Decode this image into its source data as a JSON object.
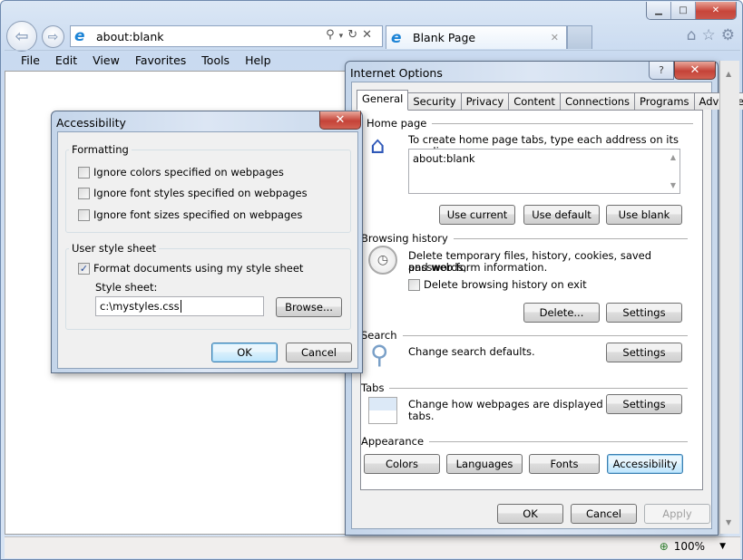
{
  "browser": {
    "address": "about:blank",
    "address_tools": [
      "search-icon",
      "dropdown-icon",
      "refresh-icon",
      "stop-icon"
    ],
    "tab_title": "Blank Page",
    "menu": [
      "File",
      "Edit",
      "View",
      "Favorites",
      "Tools",
      "Help"
    ],
    "right_icons": [
      "home-icon",
      "favorites-star-icon",
      "tools-gear-icon"
    ],
    "zoom_level": "100%"
  },
  "accessibility": {
    "title": "Accessibility",
    "formatting": {
      "label": "Formatting",
      "options": [
        {
          "label": "Ignore colors specified on webpages",
          "checked": false
        },
        {
          "label": "Ignore font styles specified on webpages",
          "checked": false
        },
        {
          "label": "Ignore font sizes specified on webpages",
          "checked": false
        }
      ]
    },
    "user_style": {
      "label": "User style sheet",
      "format_label": "Format documents using my style sheet",
      "format_checked": true,
      "sheet_label": "Style sheet:",
      "sheet_value": "c:\\mystyles.css",
      "browse": "Browse..."
    },
    "ok": "OK",
    "cancel": "Cancel"
  },
  "internet_options": {
    "title": "Internet Options",
    "tabs": [
      "General",
      "Security",
      "Privacy",
      "Content",
      "Connections",
      "Programs",
      "Advanced"
    ],
    "active_tab": "General",
    "home_page": {
      "label": "Home page",
      "desc": "To create home page tabs, type each address on its own line.",
      "value": "about:blank",
      "use_current": "Use current",
      "use_default": "Use default",
      "use_blank": "Use blank"
    },
    "history": {
      "label": "Browsing history",
      "desc1": "Delete temporary files, history, cookies, saved passwords,",
      "desc2": "and web form information.",
      "on_exit": "Delete browsing history on exit",
      "on_exit_checked": false,
      "delete": "Delete...",
      "settings": "Settings"
    },
    "search": {
      "label": "Search",
      "desc": "Change search defaults.",
      "settings": "Settings"
    },
    "tabs_section": {
      "label": "Tabs",
      "desc1": "Change how webpages are displayed in",
      "desc2": "tabs.",
      "settings": "Settings"
    },
    "appearance": {
      "label": "Appearance",
      "colors": "Colors",
      "languages": "Languages",
      "fonts": "Fonts",
      "accessibility": "Accessibility"
    },
    "ok": "OK",
    "cancel": "Cancel",
    "apply": "Apply"
  }
}
